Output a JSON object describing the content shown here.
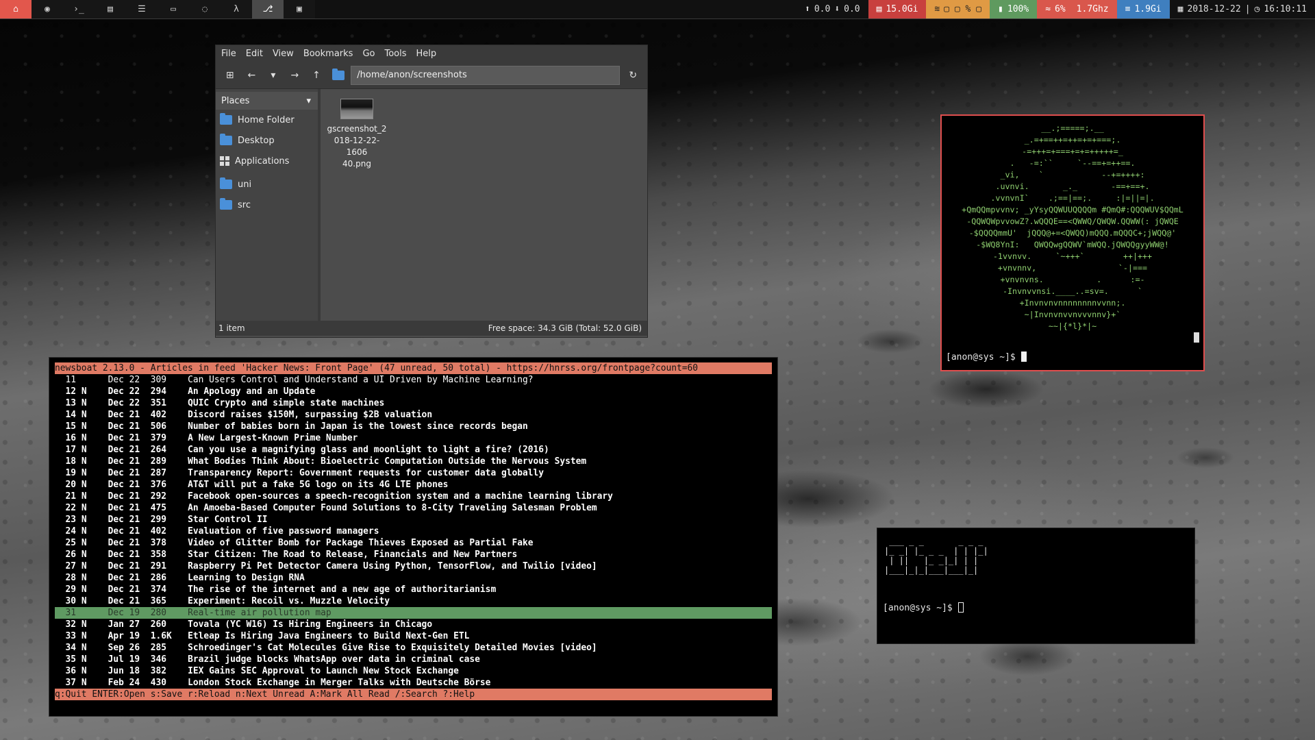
{
  "topbar": {
    "workspaces": [
      {
        "icon": "home-icon",
        "glyph": "⌂"
      },
      {
        "icon": "firefox-icon",
        "glyph": "◉"
      },
      {
        "icon": "terminal-icon",
        "glyph": "›_"
      },
      {
        "icon": "document-icon",
        "glyph": "▤"
      },
      {
        "icon": "newspaper-icon",
        "glyph": "☰"
      },
      {
        "icon": "folder-icon",
        "glyph": "▭"
      },
      {
        "icon": "chat-icon",
        "glyph": "◌"
      },
      {
        "icon": "lambda-icon",
        "glyph": "λ"
      },
      {
        "icon": "git-icon",
        "glyph": "⎇"
      },
      {
        "icon": "window-icon",
        "glyph": "▣"
      }
    ],
    "net_up": "0.0",
    "net_down": "0.0",
    "disk": "15.0Gi",
    "wifi_text": "▢  ▢ % ▢",
    "battery": "100%",
    "cpu": "6%",
    "cpu_freq": "1.7Ghz",
    "mem": "1.9Gi",
    "date": "2018-12-22",
    "time": "16:10:11"
  },
  "file_manager": {
    "menu": [
      "File",
      "Edit",
      "View",
      "Bookmarks",
      "Go",
      "Tools",
      "Help"
    ],
    "path": "/home/anon/screenshots",
    "places_label": "Places",
    "sidebar": [
      {
        "label": "Home Folder",
        "icon": "home-folder-icon"
      },
      {
        "label": "Desktop",
        "icon": "desktop-folder-icon"
      },
      {
        "label": "Applications",
        "icon": "applications-icon"
      },
      {
        "label": "uni",
        "icon": "folder-icon"
      },
      {
        "label": "src",
        "icon": "folder-icon"
      }
    ],
    "files": [
      {
        "name": "gscreenshot_2018-12-22-160640.png",
        "name_lines": [
          "gscreenshot_2",
          "018-12-22-1606",
          "40.png"
        ]
      }
    ],
    "status_left": "1 item",
    "status_right": "Free space: 34.3 GiB (Total: 52.0 GiB)"
  },
  "newsboat": {
    "header": "newsboat 2.13.0 - Articles in feed 'Hacker News: Front Page' (47 unread, 50 total) - https://hnrss.org/frontpage?count=60",
    "rows": [
      {
        "num": "11",
        "flag": " ",
        "date": "Dec 22",
        "size": "309",
        "title": "Can Users Control and Understand a UI Driven by Machine Learning?",
        "state": "read"
      },
      {
        "num": "12",
        "flag": "N",
        "date": "Dec 22",
        "size": "294",
        "title": "An Apology and an Update",
        "state": "unread"
      },
      {
        "num": "13",
        "flag": "N",
        "date": "Dec 22",
        "size": "351",
        "title": "QUIC Crypto and simple state machines",
        "state": "unread"
      },
      {
        "num": "14",
        "flag": "N",
        "date": "Dec 21",
        "size": "402",
        "title": "Discord raises $150M, surpassing $2B valuation",
        "state": "unread"
      },
      {
        "num": "15",
        "flag": "N",
        "date": "Dec 21",
        "size": "506",
        "title": "Number of babies born in Japan is the lowest since records began",
        "state": "unread"
      },
      {
        "num": "16",
        "flag": "N",
        "date": "Dec 21",
        "size": "379",
        "title": "A New Largest-Known Prime Number",
        "state": "unread"
      },
      {
        "num": "17",
        "flag": "N",
        "date": "Dec 21",
        "size": "264",
        "title": "Can you use a magnifying glass and moonlight to light a fire? (2016)",
        "state": "unread"
      },
      {
        "num": "18",
        "flag": "N",
        "date": "Dec 21",
        "size": "289",
        "title": "What Bodies Think About: Bioelectric Computation Outside the Nervous System",
        "state": "unread"
      },
      {
        "num": "19",
        "flag": "N",
        "date": "Dec 21",
        "size": "287",
        "title": "Transparency Report: Government requests for customer data globally",
        "state": "unread"
      },
      {
        "num": "20",
        "flag": "N",
        "date": "Dec 21",
        "size": "376",
        "title": "AT&T will put a fake 5G logo on its 4G LTE phones",
        "state": "unread"
      },
      {
        "num": "21",
        "flag": "N",
        "date": "Dec 21",
        "size": "292",
        "title": "Facebook open-sources a speech-recognition system and a machine learning library",
        "state": "unread"
      },
      {
        "num": "22",
        "flag": "N",
        "date": "Dec 21",
        "size": "475",
        "title": "An Amoeba-Based Computer Found Solutions to 8-City Traveling Salesman Problem",
        "state": "unread"
      },
      {
        "num": "23",
        "flag": "N",
        "date": "Dec 21",
        "size": "299",
        "title": "Star Control II",
        "state": "unread"
      },
      {
        "num": "24",
        "flag": "N",
        "date": "Dec 21",
        "size": "402",
        "title": "Evaluation of five password managers",
        "state": "unread"
      },
      {
        "num": "25",
        "flag": "N",
        "date": "Dec 21",
        "size": "378",
        "title": "Video of Glitter Bomb for Package Thieves Exposed as Partial Fake",
        "state": "unread"
      },
      {
        "num": "26",
        "flag": "N",
        "date": "Dec 21",
        "size": "358",
        "title": "Star Citizen: The Road to Release, Financials and New Partners",
        "state": "unread"
      },
      {
        "num": "27",
        "flag": "N",
        "date": "Dec 21",
        "size": "291",
        "title": "Raspberry Pi Pet Detector Camera Using Python, TensorFlow, and Twilio [video]",
        "state": "unread"
      },
      {
        "num": "28",
        "flag": "N",
        "date": "Dec 21",
        "size": "286",
        "title": "Learning to Design RNA",
        "state": "unread"
      },
      {
        "num": "29",
        "flag": "N",
        "date": "Dec 21",
        "size": "374",
        "title": "The rise of the internet and a new age of authoritarianism",
        "state": "unread"
      },
      {
        "num": "30",
        "flag": "N",
        "date": "Dec 21",
        "size": "365",
        "title": "Experiment: Recoil vs. Muzzle Velocity",
        "state": "unread"
      },
      {
        "num": "31",
        "flag": " ",
        "date": "Dec 19",
        "size": "280",
        "title": "Real-time air pollution map",
        "state": "selected"
      },
      {
        "num": "32",
        "flag": "N",
        "date": "Jan 27",
        "size": "260",
        "title": "Tovala (YC W16) Is Hiring Engineers in Chicago",
        "state": "unread"
      },
      {
        "num": "33",
        "flag": "N",
        "date": "Apr 19",
        "size": "1.6K",
        "title": "Etleap Is Hiring Java Engineers to Build Next-Gen ETL",
        "state": "unread"
      },
      {
        "num": "34",
        "flag": "N",
        "date": "Sep 26",
        "size": "285",
        "title": "Schroedinger's Cat Molecules Give Rise to Exquisitely Detailed Movies [video]",
        "state": "unread"
      },
      {
        "num": "35",
        "flag": "N",
        "date": "Jul 19",
        "size": "346",
        "title": "Brazil judge blocks WhatsApp over data in criminal case",
        "state": "unread"
      },
      {
        "num": "36",
        "flag": "N",
        "date": "Jun 18",
        "size": "382",
        "title": "IEX Gains SEC Approval to Launch New Stock Exchange",
        "state": "unread"
      },
      {
        "num": "37",
        "flag": "N",
        "date": "Feb 24",
        "size": "430",
        "title": "London Stock Exchange in Merger Talks with Deutsche Börse",
        "state": "unread"
      }
    ],
    "footer": "q:Quit ENTER:Open s:Save r:Reload n:Next Unread A:Mark All Read /:Search ?:Help"
  },
  "terminal_logo": {
    "ascii_lines": [
      "__.;=====;.__",
      "_.=+==++=++=+=+===;.",
      "-=+++=+===+=+=+++++=_",
      ".   -=:``     `--==+=++==.",
      "_vi,    `            --+=++++:",
      ".uvnvi.       _._       -==+==+.",
      ".vvnvnI`    .;==|==;.     :|=||=|.",
      "+QmQQmpvvnv; _yYsyQQWUUQQQQm #QmQ#:QQQWUV$QQmL",
      "-QQWQWpvvowZ?.wQQQE==<QWWQ/QWQW.QQWW(: jQWQE",
      "-$QQQQmmU'  jQQQ@+=<QWQQ)mQQQ.mQQQC+;jWQQ@'",
      "-$WQ8YnI:   QWQQwgQQWV`mWQQ.jQWQQgyyWW@!",
      "-1vvnvv.     `~+++`        ++|+++",
      "+vnvnnv,                 `-|===",
      "+vnvnvns.           .      :=-",
      "-Invnvvnsi.____..=sv=.      `",
      "+Invnvnvnnnnnnnnvvnn;.",
      "~|Invnvnvvnvvvnnv}+`",
      "~~|{*l}*|~"
    ],
    "prompt": "[anon@sys ~]$ "
  },
  "terminal_figlet": {
    "figlet_lines": [
      " ___ _ _       _ _ _ ",
      "|_ _| |_ _ _  | | |_|",
      " | ||   |_ _|_| | |   ",
      "|___|_|_|___|___|_|   "
    ],
    "prompt": "[anon@sys ~]$ "
  }
}
